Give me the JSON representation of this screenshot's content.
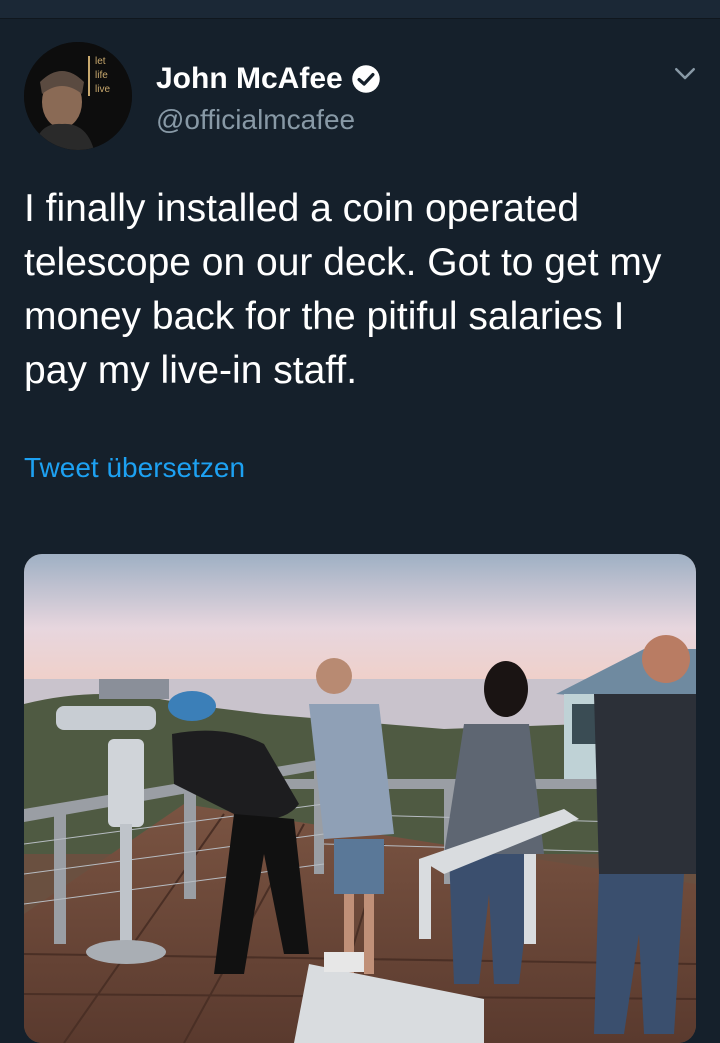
{
  "tweet": {
    "author_name": "John McAfee",
    "author_handle": "@officialmcafee",
    "verified": true,
    "text": "I finally installed a coin operated telescope on our deck. Got to get my money back for the pitiful salaries I pay my live-in staff.",
    "translate_label": "Tweet übersetzen",
    "avatar_caption": [
      "let",
      "life",
      "live"
    ],
    "media_description_icon": "photo"
  },
  "icons": {
    "verified": "verified-badge-icon",
    "menu": "chevron-down-icon"
  },
  "colors": {
    "background": "#15202b",
    "link": "#1da1f2",
    "secondary_text": "#8899a6"
  }
}
